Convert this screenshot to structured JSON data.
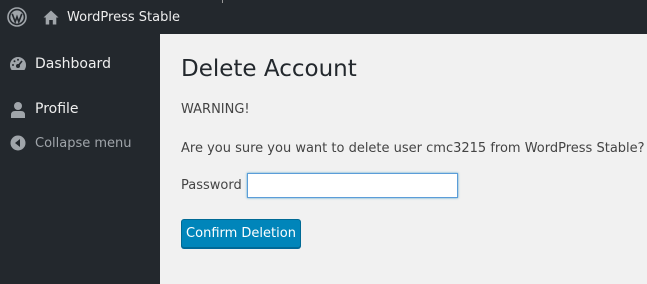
{
  "adminbar": {
    "logo_icon": "wordpress-logo-icon",
    "home_icon": "home-icon",
    "site_name": "WordPress Stable"
  },
  "sidebar": {
    "items": [
      {
        "label": "Dashboard",
        "icon": "dashboard-icon"
      },
      {
        "label": "Profile",
        "icon": "user-icon"
      },
      {
        "label": "Collapse menu",
        "icon": "collapse-arrow-icon"
      }
    ]
  },
  "main": {
    "title": "Delete Account",
    "warning": "WARNING!",
    "confirm_text": "Are you sure you want to delete user cmc3215 from WordPress Stable?",
    "password_label": "Password",
    "password_value": "",
    "confirm_button": "Confirm Deletion"
  },
  "colors": {
    "adminbar_bg": "#23282d",
    "sidebar_bg": "#23282d",
    "content_bg": "#f1f1f1",
    "primary_button": "#0085ba"
  }
}
